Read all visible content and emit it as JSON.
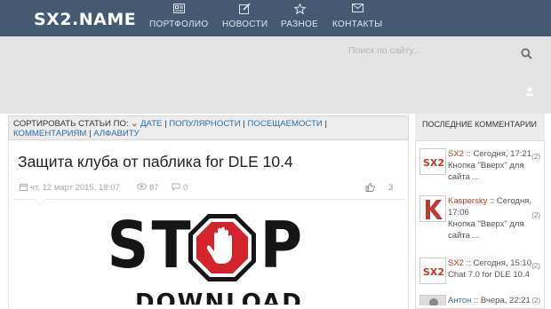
{
  "header": {
    "logo": "SX2.NAME",
    "nav": [
      {
        "label": "ПОРТФОЛИО",
        "icon": "portfolio-icon"
      },
      {
        "label": "НОВОСТИ",
        "icon": "edit-icon"
      },
      {
        "label": "РАЗНОЕ",
        "icon": "star-icon"
      },
      {
        "label": "КОНТАКТЫ",
        "icon": "mail-icon"
      }
    ]
  },
  "search": {
    "placeholder": "Поиск по сайту..."
  },
  "sort": {
    "prefix": "Сортировать статьи по:",
    "chevron": "⌄",
    "options": [
      "дате",
      "популярности",
      "посещаемости",
      "комментариям",
      "алфавиту"
    ],
    "separator": " | "
  },
  "article": {
    "title": "Защита клуба от паблика for DLE 10.4",
    "date": "чт, 12 март 2015, 18:07",
    "views": "87",
    "comments": "0",
    "likes": "3",
    "banner_top": [
      "S",
      "T",
      "O",
      "P"
    ],
    "banner_bottom": "DOWNLOAD"
  },
  "sidebar": {
    "title": "Последние комментарии",
    "comments": [
      {
        "author": "SX2",
        "sep": " :: ",
        "time": "Сегодня, 17:21",
        "count": "(2)",
        "text": "Кнопка \"Вверх\" для сайта ..."
      },
      {
        "author": "Kaspersky",
        "sep": " :: ",
        "time": "Сегодня, 17:06",
        "count": "(2)",
        "text": "Кнопка \"Вверх\" для сайта ..."
      },
      {
        "author": "SX2",
        "sep": " :: ",
        "time": "Сегодня, 15:10",
        "count": "(2)",
        "text": "Chat 7.0 for DLE 10.4"
      },
      {
        "author": "Антон",
        "sep": " :: ",
        "time": "Вчера, 22:21",
        "count": "(2)",
        "text": ""
      }
    ]
  },
  "colors": {
    "topbar": "#455a72",
    "accent_red": "#c0392b",
    "link_blue": "#2a6ea6",
    "gray_band": "#e4e4e4"
  }
}
